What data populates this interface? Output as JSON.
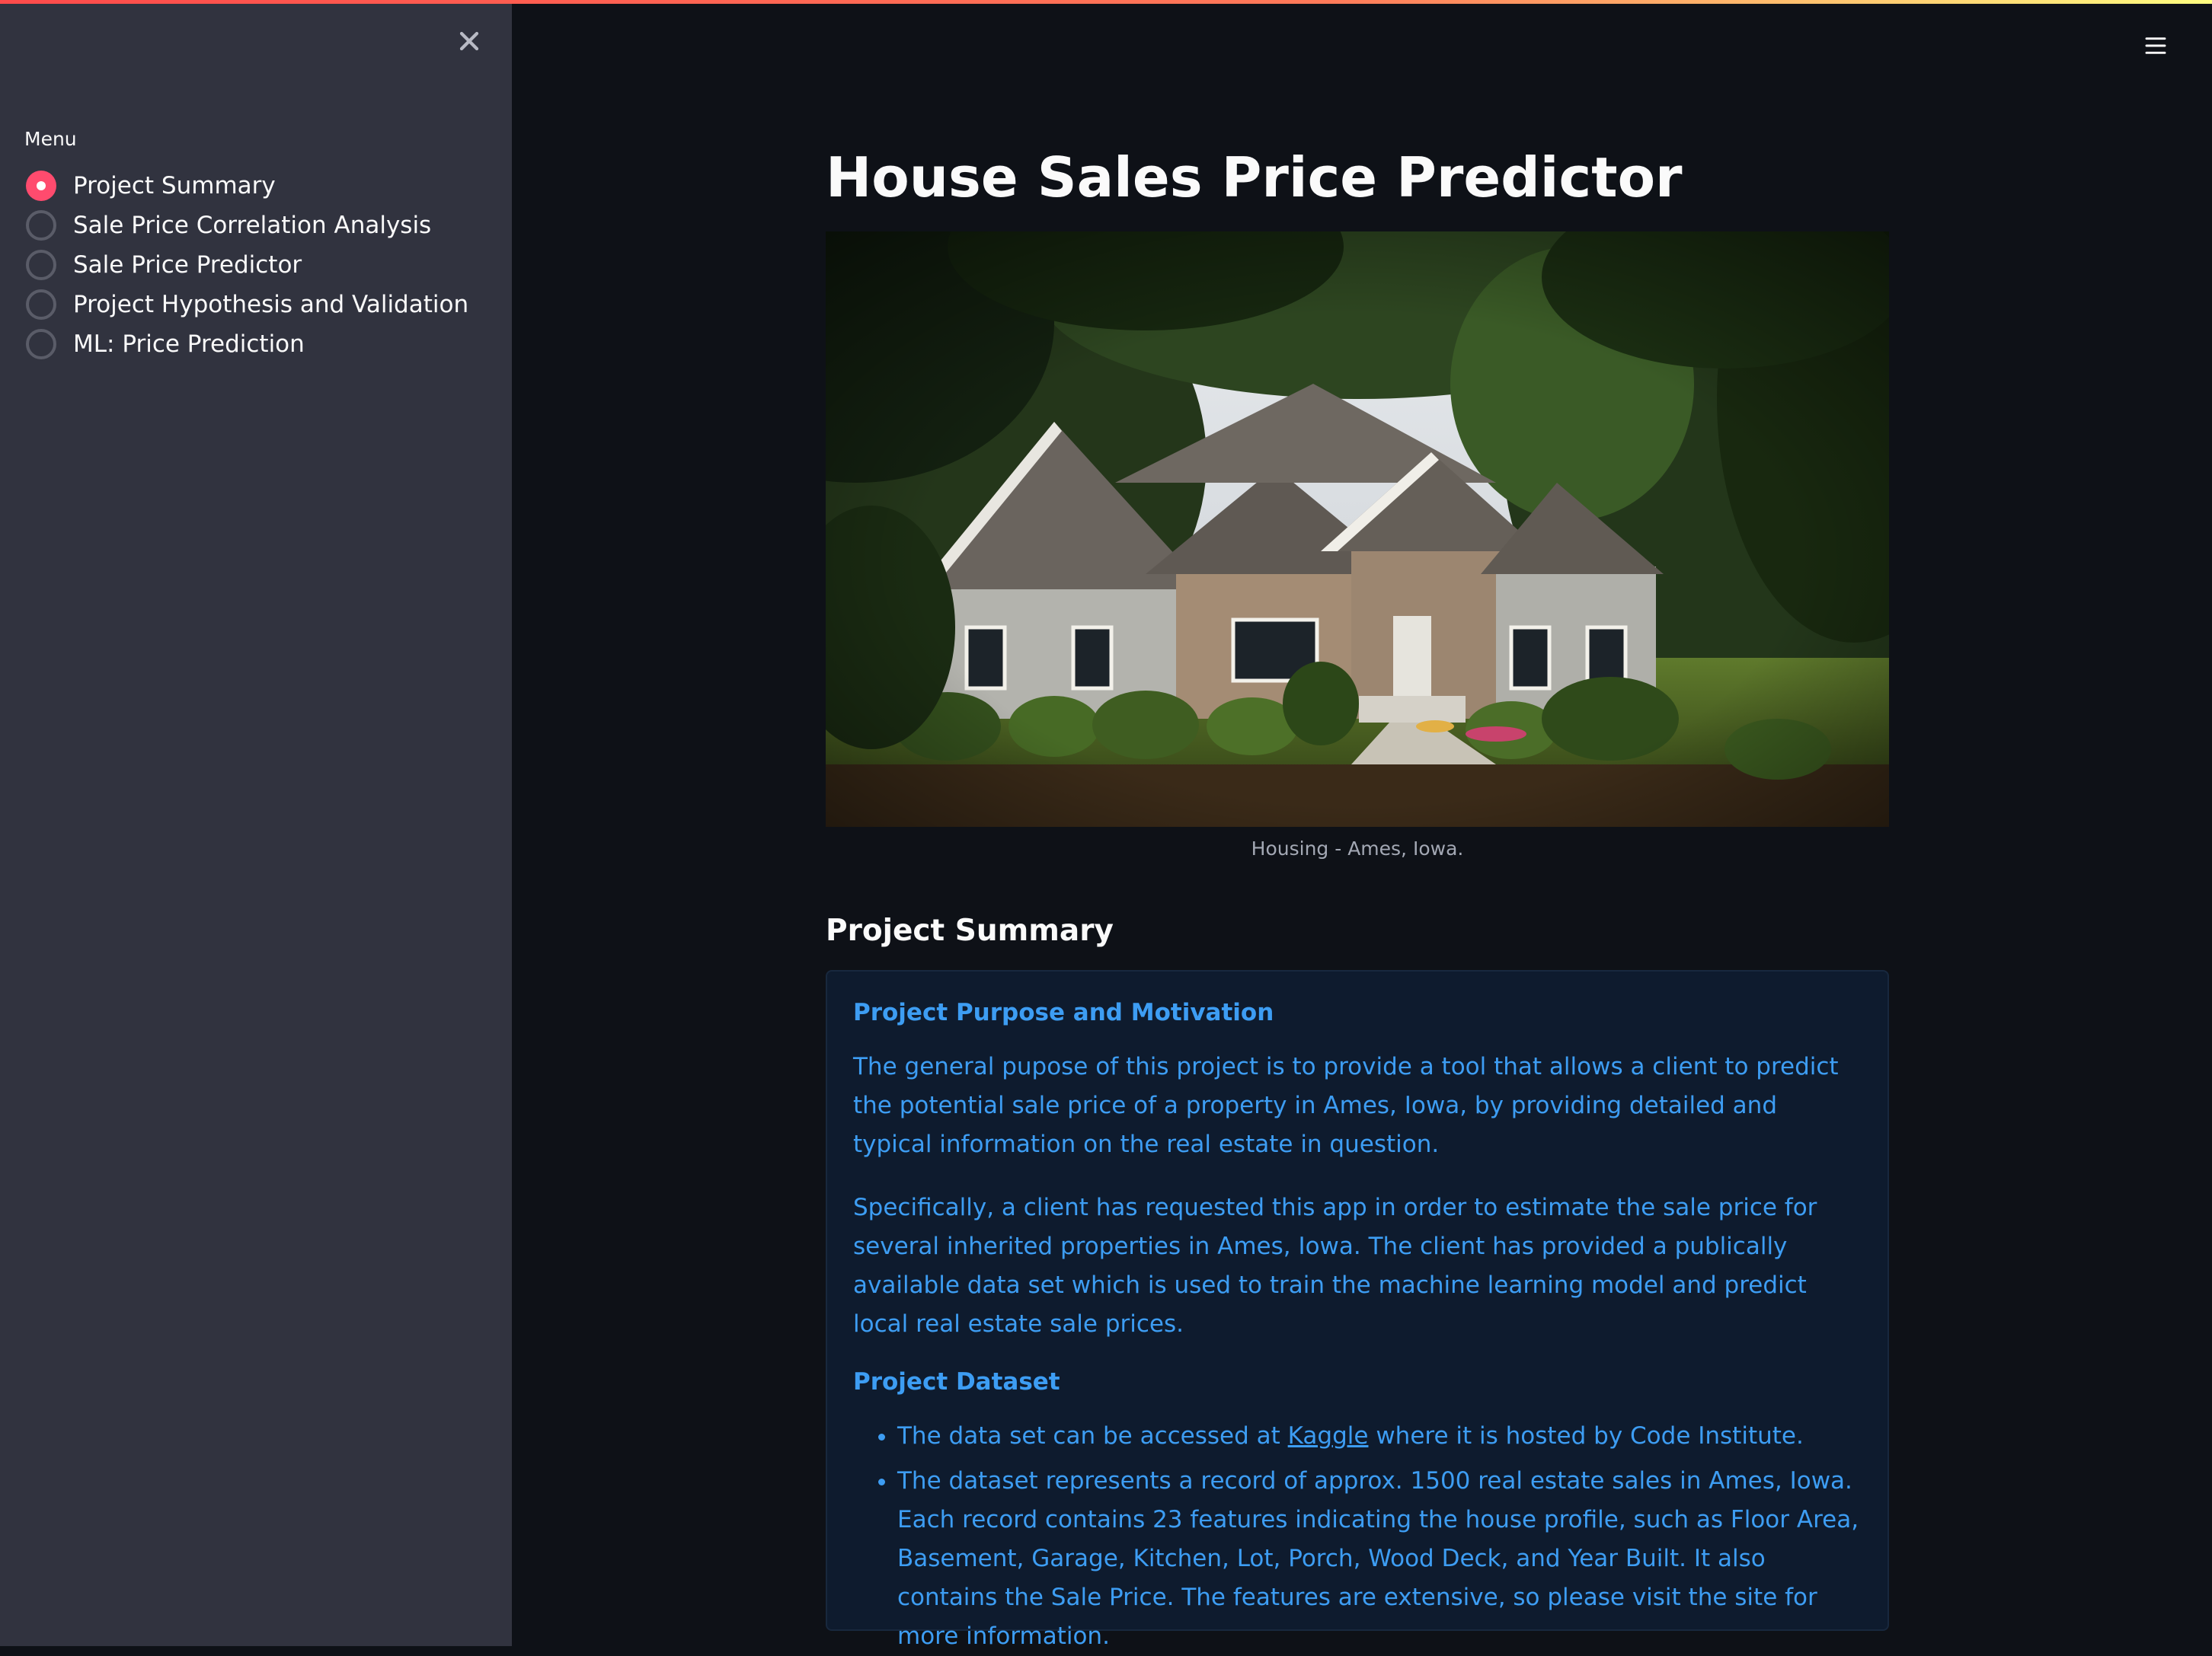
{
  "sidebar": {
    "close_icon": "close-icon",
    "menu_label": "Menu",
    "items": [
      {
        "label": "Project Summary",
        "selected": true
      },
      {
        "label": "Sale Price Correlation Analysis",
        "selected": false
      },
      {
        "label": "Sale Price Predictor",
        "selected": false
      },
      {
        "label": "Project Hypothesis and Validation",
        "selected": false
      },
      {
        "label": "ML: Price Prediction",
        "selected": false
      }
    ]
  },
  "header": {
    "menu_icon": "hamburger-menu-icon",
    "accent_gradient": [
      "#ff4b4b",
      "#fffd80"
    ]
  },
  "main": {
    "title": "House Sales Price Predictor",
    "image": {
      "subject": "house-photo",
      "caption": "Housing - Ames, Iowa."
    },
    "section_heading": "Project Summary",
    "info_box": {
      "purpose_heading": "Project Purpose and Motivation",
      "purpose_para_1": "The general pupose of this project is to provide a tool that allows a client to predict the potential sale price of a property in Ames, Iowa, by providing detailed and typical information on the real estate in question.",
      "purpose_para_2": "Specifically, a client has requested this app in order to estimate the sale price for several inherited properties in Ames, Iowa. The client has provided a publically available data set which is used to train the machine learning model and predict local real estate sale prices.",
      "dataset_heading": "Project Dataset",
      "bullet_1_before": "The data set can be accessed at ",
      "bullet_1_link": "Kaggle",
      "bullet_1_after": " where it is hosted by Code Institute.",
      "bullet_2": "The dataset represents a record of approx. 1500 real estate sales in Ames, Iowa. Each record contains 23 features indicating the house profile, such as Floor Area, Basement, Garage, Kitchen, Lot, Porch, Wood Deck, and Year Built. It also contains the Sale Price. The features are extensive, so please visit the site for more information."
    }
  },
  "colors": {
    "background": "#0e1117",
    "sidebar": "#31333f",
    "accent": "#ff4b6e",
    "info_text": "#3d9df3",
    "info_bg": "#0e1b2e"
  }
}
